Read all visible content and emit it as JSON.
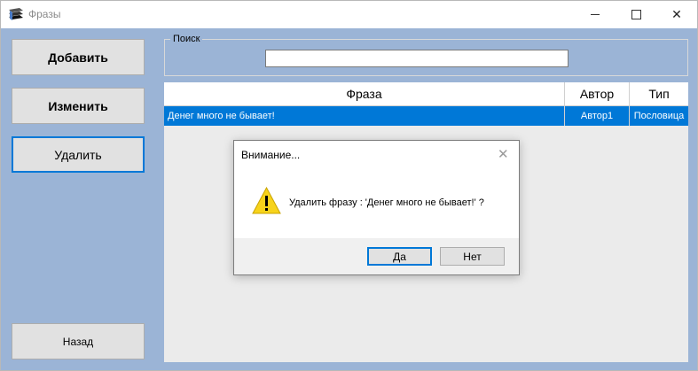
{
  "window": {
    "title": "Фразы"
  },
  "buttons": {
    "add": "Добавить",
    "edit": "Изменить",
    "delete": "Удалить",
    "back": "Назад"
  },
  "search": {
    "label": "Поиск",
    "value": ""
  },
  "grid": {
    "columns": [
      "Фраза",
      "Автор",
      "Тип"
    ],
    "rows": [
      {
        "phrase": "Денег много не бывает!",
        "author": "Автор1",
        "type": "Пословица",
        "selected": true
      }
    ]
  },
  "dialog": {
    "title": "Внимание...",
    "message": "Удалить фразу : 'Денег много не бывает!' ?",
    "yes": "Да",
    "no": "Нет",
    "icon": "warning-icon"
  },
  "colors": {
    "background": "#9bb4d6",
    "selection": "#0078d7",
    "warning": "#f7d31b"
  }
}
